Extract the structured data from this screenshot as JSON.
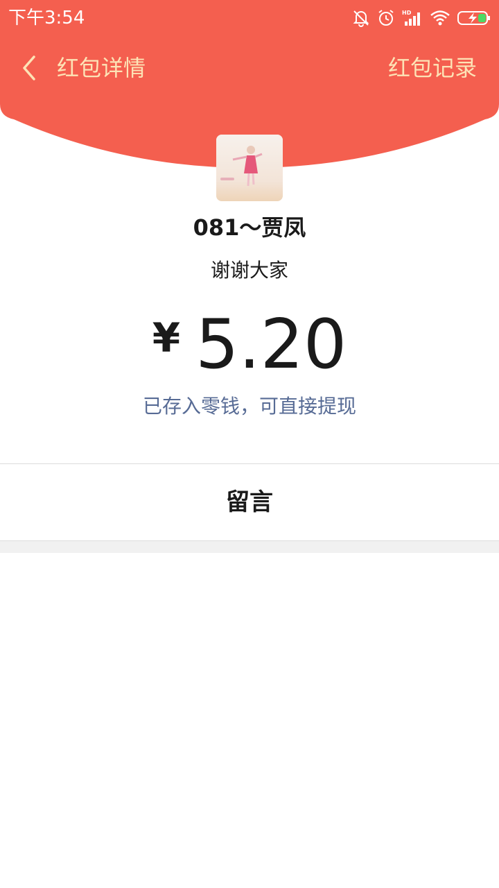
{
  "status_bar": {
    "time": "下午3:54",
    "icons": [
      "bell-off-icon",
      "alarm-icon",
      "hd-signal-icon",
      "wifi-icon",
      "battery-charging-icon"
    ]
  },
  "nav": {
    "title": "红包详情",
    "record_label": "红包记录"
  },
  "packet": {
    "sender": "081～贾凤",
    "message": "谢谢大家",
    "currency": "¥",
    "amount": "5.20",
    "stored_note": "已存入零钱，可直接提现"
  },
  "reply": {
    "label": "留言"
  },
  "colors": {
    "header_red": "#f45f4f",
    "nav_text": "#fde3b6",
    "link_blue": "#576b95"
  }
}
